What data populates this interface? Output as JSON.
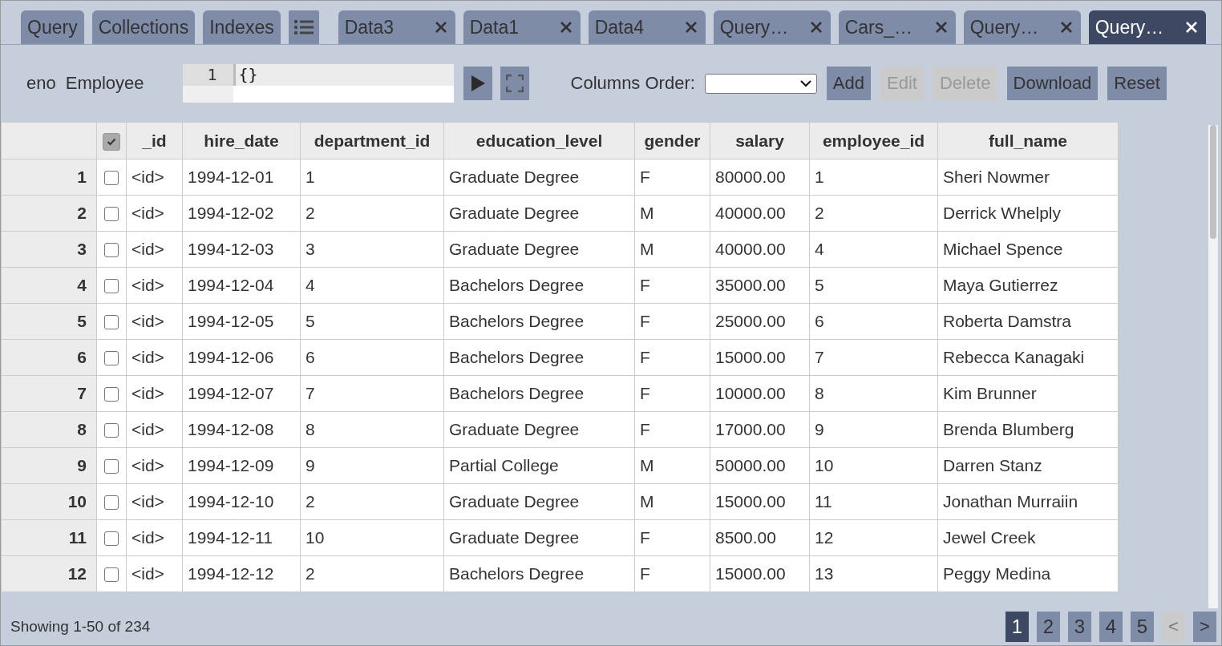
{
  "tabs": [
    {
      "label": "Query",
      "kind": "plain",
      "selected": false
    },
    {
      "label": "Collections",
      "kind": "plain",
      "selected": false
    },
    {
      "label": "Indexes",
      "kind": "plain",
      "selected": false
    },
    {
      "kind": "menu",
      "selected": false
    },
    {
      "label": "Data3",
      "kind": "closable",
      "selected": false
    },
    {
      "label": "Data1",
      "kind": "closable",
      "selected": false
    },
    {
      "label": "Data4",
      "kind": "closable",
      "selected": false
    },
    {
      "label": "Query…",
      "kind": "closable",
      "selected": false
    },
    {
      "label": "Cars_…",
      "kind": "closable",
      "selected": false
    },
    {
      "label": "Query…",
      "kind": "closable",
      "selected": false
    },
    {
      "label": "Query…",
      "kind": "closable",
      "selected": true
    }
  ],
  "toolbar": {
    "db": "eno",
    "collection": "Employee",
    "editor": {
      "line_number": "1",
      "value": "{}"
    },
    "columns_order_label": "Columns Order:",
    "buttons": [
      {
        "label": "Add",
        "disabled": false
      },
      {
        "label": "Edit",
        "disabled": true
      },
      {
        "label": "Delete",
        "disabled": true
      },
      {
        "label": "Download",
        "disabled": false
      },
      {
        "label": "Reset",
        "disabled": false
      }
    ]
  },
  "table": {
    "select_all_checked": true,
    "columns": [
      "_id",
      "hire_date",
      "department_id",
      "education_level",
      "gender",
      "salary",
      "employee_id",
      "full_name"
    ],
    "rows": [
      {
        "index": "1",
        "checked": false,
        "cells": [
          "<id>",
          "1994-12-01",
          "1",
          "Graduate Degree",
          "F",
          "80000.00",
          "1",
          "Sheri Nowmer"
        ]
      },
      {
        "index": "2",
        "checked": false,
        "cells": [
          "<id>",
          "1994-12-02",
          "2",
          "Graduate Degree",
          "M",
          "40000.00",
          "2",
          "Derrick Whelply"
        ]
      },
      {
        "index": "3",
        "checked": false,
        "cells": [
          "<id>",
          "1994-12-03",
          "3",
          "Graduate Degree",
          "M",
          "40000.00",
          "4",
          "Michael Spence"
        ]
      },
      {
        "index": "4",
        "checked": false,
        "cells": [
          "<id>",
          "1994-12-04",
          "4",
          "Bachelors Degree",
          "F",
          "35000.00",
          "5",
          "Maya Gutierrez"
        ]
      },
      {
        "index": "5",
        "checked": false,
        "cells": [
          "<id>",
          "1994-12-05",
          "5",
          "Bachelors Degree",
          "F",
          "25000.00",
          "6",
          "Roberta Damstra"
        ]
      },
      {
        "index": "6",
        "checked": false,
        "cells": [
          "<id>",
          "1994-12-06",
          "6",
          "Bachelors Degree",
          "F",
          "15000.00",
          "7",
          "Rebecca Kanagaki"
        ]
      },
      {
        "index": "7",
        "checked": false,
        "cells": [
          "<id>",
          "1994-12-07",
          "7",
          "Bachelors Degree",
          "F",
          "10000.00",
          "8",
          "Kim Brunner"
        ]
      },
      {
        "index": "8",
        "checked": false,
        "cells": [
          "<id>",
          "1994-12-08",
          "8",
          "Graduate Degree",
          "F",
          "17000.00",
          "9",
          "Brenda Blumberg"
        ]
      },
      {
        "index": "9",
        "checked": false,
        "cells": [
          "<id>",
          "1994-12-09",
          "9",
          "Partial College",
          "M",
          "50000.00",
          "10",
          "Darren Stanz"
        ]
      },
      {
        "index": "10",
        "checked": false,
        "cells": [
          "<id>",
          "1994-12-10",
          "2",
          "Graduate Degree",
          "M",
          "15000.00",
          "11",
          "Jonathan Murraiin"
        ]
      },
      {
        "index": "11",
        "checked": false,
        "cells": [
          "<id>",
          "1994-12-11",
          "10",
          "Graduate Degree",
          "F",
          "8500.00",
          "12",
          "Jewel Creek"
        ]
      },
      {
        "index": "12",
        "checked": false,
        "cells": [
          "<id>",
          "1994-12-12",
          "2",
          "Bachelors Degree",
          "F",
          "15000.00",
          "13",
          "Peggy Medina"
        ]
      }
    ]
  },
  "footer": {
    "status": "Showing 1-50 of 234",
    "pages": [
      {
        "label": "1",
        "kind": "page",
        "selected": true,
        "disabled": false
      },
      {
        "label": "2",
        "kind": "page",
        "selected": false,
        "disabled": false
      },
      {
        "label": "3",
        "kind": "page",
        "selected": false,
        "disabled": false
      },
      {
        "label": "4",
        "kind": "page",
        "selected": false,
        "disabled": false
      },
      {
        "label": "5",
        "kind": "page",
        "selected": false,
        "disabled": false
      },
      {
        "label": "<",
        "kind": "nav",
        "selected": false,
        "disabled": true
      },
      {
        "label": ">",
        "kind": "nav",
        "selected": false,
        "disabled": false
      }
    ]
  }
}
